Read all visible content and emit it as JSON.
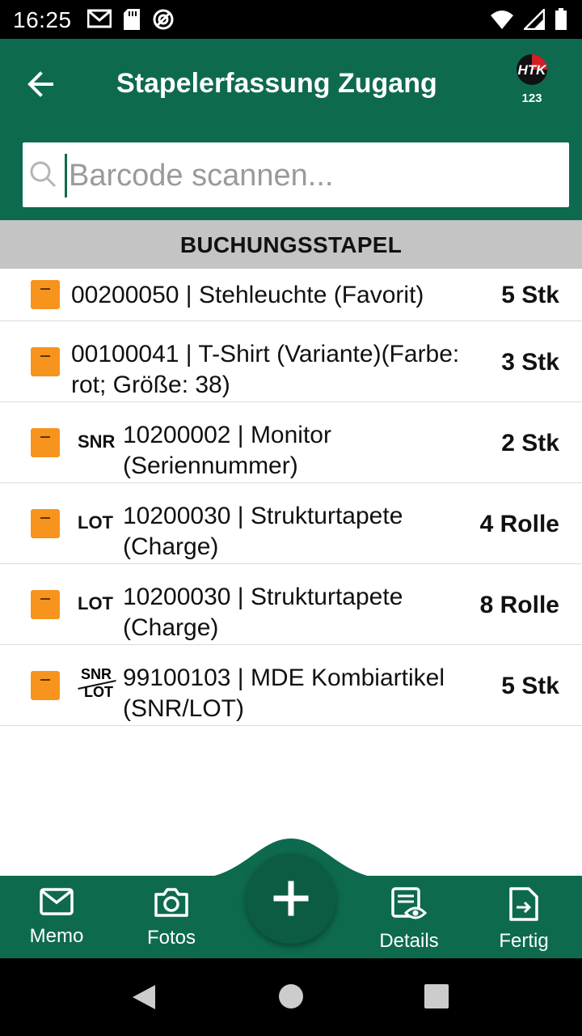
{
  "status_bar": {
    "time": "16:25",
    "left_icons": [
      "mail-icon",
      "sd-card-icon",
      "sync-icon"
    ],
    "right_icons": [
      "wifi-icon",
      "signal-icon",
      "battery-icon"
    ]
  },
  "app_bar": {
    "title": "Stapelerfassung Zugang",
    "back_icon": "arrow-left-icon",
    "logo_text": "HTK",
    "badge": "123"
  },
  "search": {
    "placeholder": "Barcode scannen...",
    "value": ""
  },
  "section": {
    "title": "BUCHUNGSSTAPEL"
  },
  "items": [
    {
      "tag": "",
      "text_line1": "00200050 | Stehleuchte  (Favorit)",
      "text_line2": "",
      "qty": "5 Stk"
    },
    {
      "tag": "",
      "text_line1": "00100041 | T-Shirt (Variante)(Farbe:",
      "text_line2": "rot; Größe: 38)",
      "qty": "3 Stk"
    },
    {
      "tag": "SNR",
      "text_line1": "10200002 | Monitor",
      "text_line2": "(Seriennummer)",
      "qty": "2 Stk"
    },
    {
      "tag": "LOT",
      "text_line1": "10200030 | Strukturtapete",
      "text_line2": "(Charge)",
      "qty": "4 Rolle"
    },
    {
      "tag": "LOT",
      "text_line1": "10200030 | Strukturtapete",
      "text_line2": "(Charge)",
      "qty": "8 Rolle"
    },
    {
      "tag_top": "SNR",
      "tag_bottom": "LOT",
      "text_line1": "99100103 | MDE Kombiartikel",
      "text_line2": "(SNR/LOT)",
      "qty": "5 Stk"
    }
  ],
  "bottom_nav": {
    "memo": "Memo",
    "fotos": "Fotos",
    "details": "Details",
    "fertig": "Fertig",
    "fab_icon": "plus-icon"
  },
  "colors": {
    "primary": "#0e6a4f",
    "checkbox": "#f7941d",
    "section_bg": "#c4c4c4"
  }
}
